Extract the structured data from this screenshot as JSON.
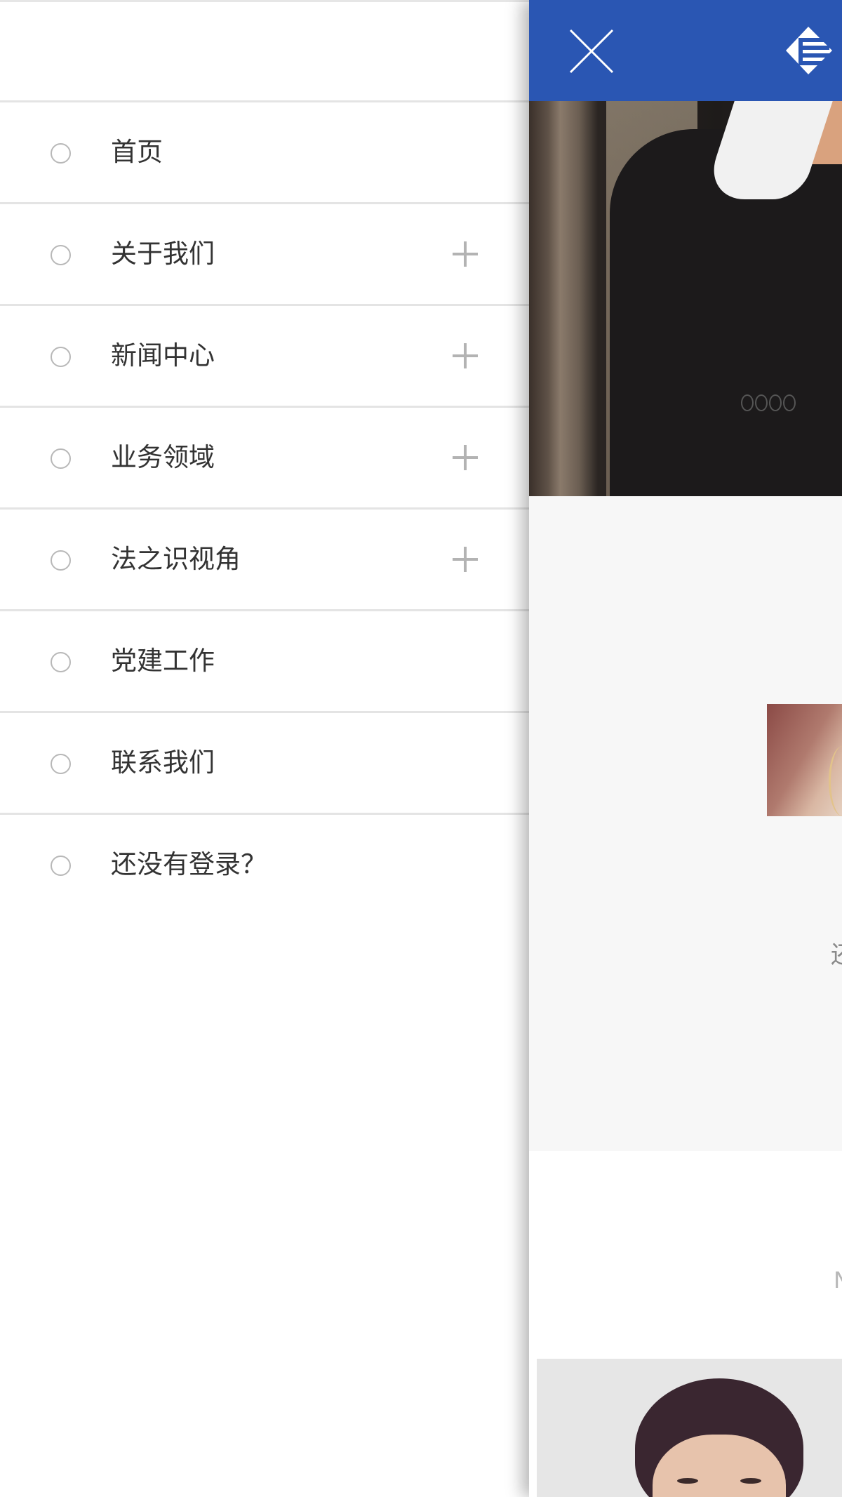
{
  "menu": {
    "items": [
      {
        "label": "首页",
        "expandable": false
      },
      {
        "label": "关于我们",
        "expandable": true
      },
      {
        "label": "新闻中心",
        "expandable": true
      },
      {
        "label": "业务领域",
        "expandable": true
      },
      {
        "label": "法之识视角",
        "expandable": true
      },
      {
        "label": "党建工作",
        "expandable": false
      },
      {
        "label": "联系我们",
        "expandable": false
      },
      {
        "label": "还没有登录？",
        "expandable": false
      }
    ]
  },
  "page": {
    "header_color": "#2a56b3",
    "gray_section_text": "还",
    "white_section_text": "N"
  },
  "icons": {
    "bullet": "circle-outline-icon",
    "expand": "plus-icon",
    "close": "close-x-icon",
    "logo": "brand-logo-icon"
  }
}
